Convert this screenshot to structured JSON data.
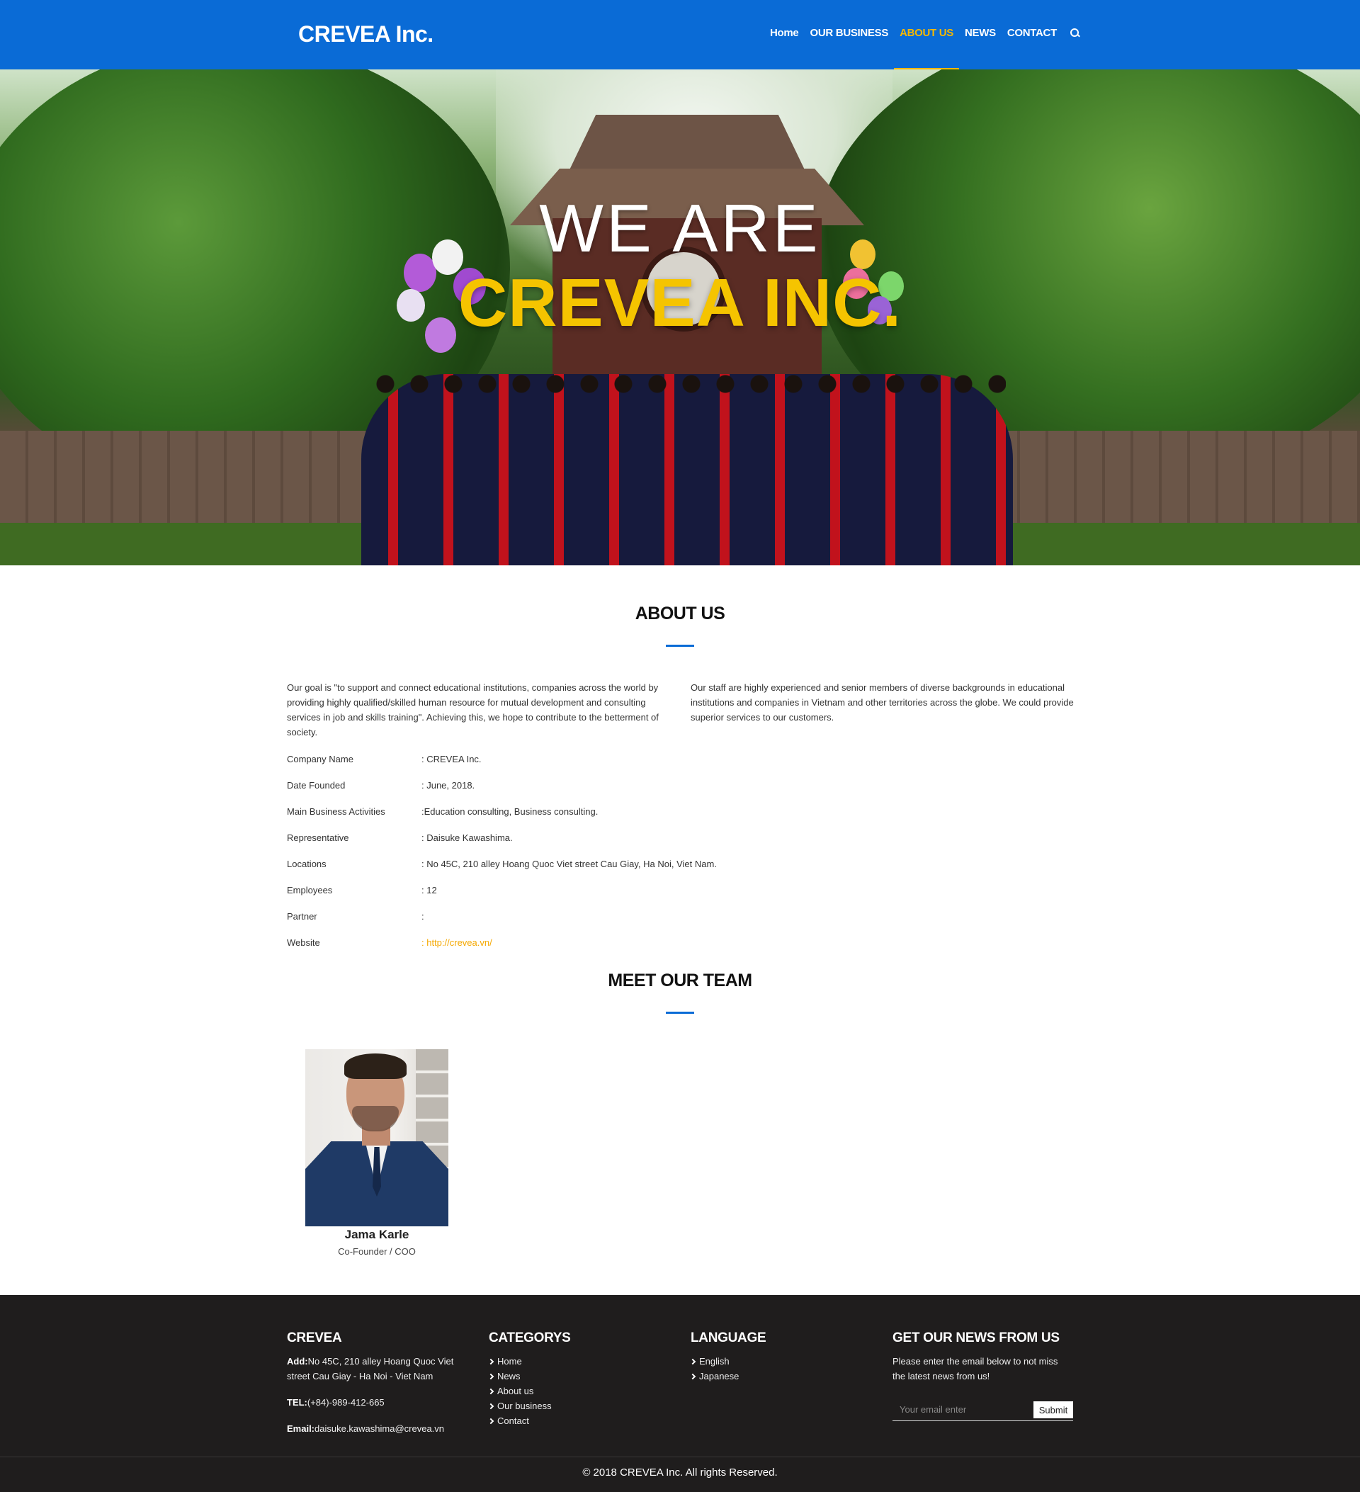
{
  "header": {
    "logo": "CREVEA Inc.",
    "nav": [
      {
        "label": "Home"
      },
      {
        "label": "OUR BUSINESS"
      },
      {
        "label": "ABOUT US"
      },
      {
        "label": "NEWS"
      },
      {
        "label": "CONTACT"
      }
    ],
    "active_nav": "ABOUT US",
    "search_icon": "search-icon"
  },
  "hero": {
    "line1": "WE ARE",
    "line2": "CREVEA INC."
  },
  "about": {
    "title": "ABOUT US",
    "paragraph_left": "Our goal is \"to support and connect educational institutions, companies across the world by providing highly qualified/skilled human resource for mutual development and consulting services in job and skills training\". Achieving this, we hope to contribute to the betterment of society.",
    "paragraph_right": "Our staff are highly experienced and senior members of diverse backgrounds in educational institutions and companies in Vietnam and other territories across the globe. We could provide superior services to our customers.",
    "info": [
      {
        "label": "Company Name",
        "value": ": CREVEA Inc."
      },
      {
        "label": "Date Founded",
        "value": ": June, 2018."
      },
      {
        "label": "Main Business Activities",
        "value": ":Education consulting, Business consulting."
      },
      {
        "label": "Representative",
        "value": ": Daisuke Kawashima."
      },
      {
        "label": "Locations",
        "value": ": No 45C, 210 alley Hoang Quoc Viet street Cau Giay, Ha Noi, Viet Nam."
      },
      {
        "label": "Employees",
        "value": ": 12"
      },
      {
        "label": "Partner",
        "value": ":"
      },
      {
        "label": "Website",
        "value": ": http://crevea.vn/"
      }
    ]
  },
  "team": {
    "title": "MEET OUR TEAM",
    "members": [
      {
        "name": "Jama Karle",
        "role": "Co-Founder / COO"
      }
    ]
  },
  "footer": {
    "col1": {
      "heading": "CREVEA",
      "add_label": "Add:",
      "add_value": "No 45C, 210 alley Hoang Quoc Viet street Cau Giay - Ha Noi - Viet Nam",
      "tel_label": "TEL:",
      "tel_value": "(+84)-989-412-665",
      "email_label": "Email:",
      "email_value": "daisuke.kawashima@crevea.vn"
    },
    "col2": {
      "heading": "CATEGORYS",
      "links": [
        "Home",
        "News",
        "About us",
        "Our business",
        "Contact"
      ]
    },
    "col3": {
      "heading": "LANGUAGE",
      "links": [
        "English",
        "Japanese"
      ]
    },
    "col4": {
      "heading": "GET OUR NEWS FROM US",
      "text": "Please enter the email below to not miss the latest news from us!",
      "placeholder": "Your email enter",
      "submit": "Submit"
    },
    "copyright": "© 2018 CREVEA Inc. All rights Reserved."
  },
  "colors": {
    "header_bg": "#0a6bd6",
    "accent": "#f5b800",
    "footer_bg": "#1f1d1d"
  }
}
